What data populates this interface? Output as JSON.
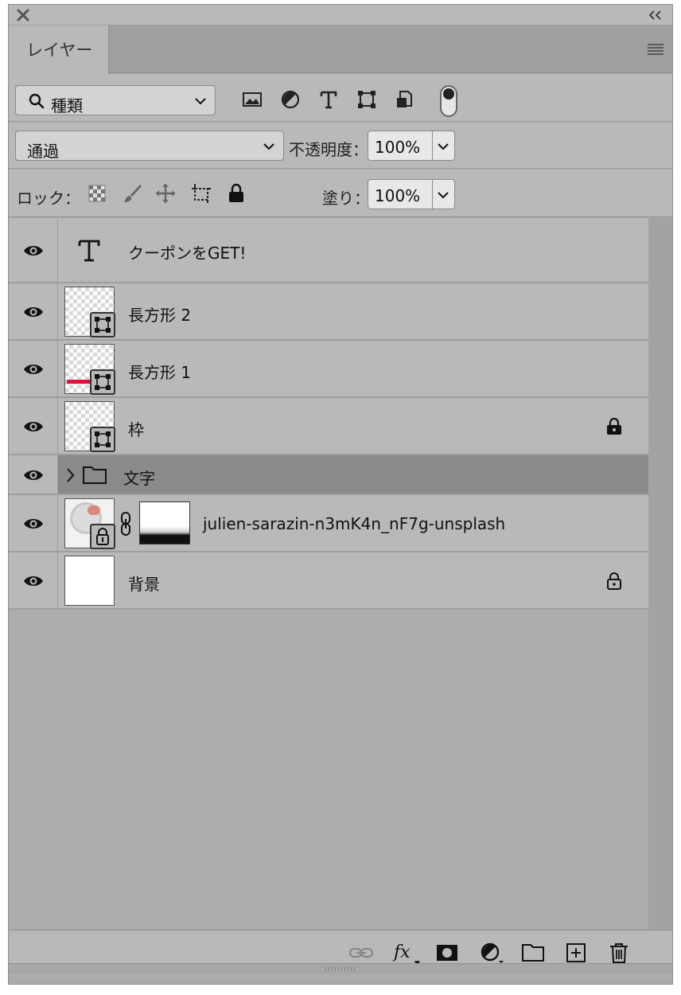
{
  "panel": {
    "tab_label": "レイヤー"
  },
  "filter": {
    "kind_label": "種類",
    "icons": [
      "image-filter-icon",
      "adjustment-filter-icon",
      "type-filter-icon",
      "shape-filter-icon",
      "smart-object-filter-icon",
      "filter-toggle-icon"
    ]
  },
  "blend": {
    "mode": "通過",
    "opacity_label": "不透明度：",
    "opacity_value": "100%"
  },
  "lock": {
    "label": "ロック：",
    "icons": [
      "lock-transparent-icon",
      "lock-paint-icon",
      "lock-position-icon",
      "lock-artboard-icon",
      "lock-all-icon"
    ],
    "fill_label": "塗り：",
    "fill_value": "100%"
  },
  "layers": [
    {
      "name": "クーポンをGET!",
      "kind": "text",
      "locked": false,
      "selected": false
    },
    {
      "name": "長方形 2",
      "kind": "shape",
      "locked": false,
      "selected": false
    },
    {
      "name": "長方形 1",
      "kind": "shape",
      "locked": false,
      "selected": false,
      "thumb_accent": "#e0103a"
    },
    {
      "name": "枠",
      "kind": "shape",
      "locked": true,
      "selected": false
    },
    {
      "name": "文字",
      "kind": "group",
      "locked": false,
      "selected": true
    },
    {
      "name": "julien-sarazin-n3mK4n_nF7g-unsplash",
      "kind": "smart-object-masked",
      "locked": false,
      "selected": false
    },
    {
      "name": "背景",
      "kind": "background",
      "locked": true,
      "selected": false
    }
  ],
  "footer": {
    "buttons": [
      "link-layers-icon",
      "fx-icon",
      "add-mask-icon",
      "adjustment-layer-icon",
      "new-group-icon",
      "new-layer-icon",
      "delete-icon"
    ],
    "fx_label": "fx"
  },
  "colors": {
    "panel_bg": "#b9b9b9",
    "selected_row": "#8a8a8a",
    "accent_red": "#e0103a"
  }
}
